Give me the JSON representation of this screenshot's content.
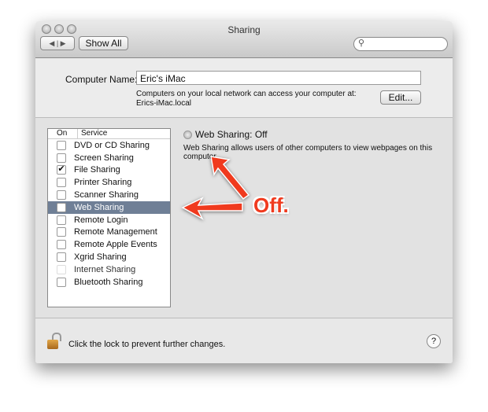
{
  "window": {
    "title": "Sharing"
  },
  "toolbar": {
    "back_icon": "triangle-left",
    "forward_icon": "triangle-right",
    "show_all": "Show All",
    "search_placeholder": ""
  },
  "computer": {
    "label": "Computer Name:",
    "value": "Eric's iMac",
    "info": "Computers on your local network can access your computer at:",
    "address": "Erics-iMac.local",
    "edit": "Edit..."
  },
  "list": {
    "col_on": "On",
    "col_service": "Service",
    "items": [
      {
        "label": "DVD or CD Sharing",
        "checked": false
      },
      {
        "label": "Screen Sharing",
        "checked": false
      },
      {
        "label": "File Sharing",
        "checked": true
      },
      {
        "label": "Printer Sharing",
        "checked": false
      },
      {
        "label": "Scanner Sharing",
        "checked": false
      },
      {
        "label": "Web Sharing",
        "checked": false,
        "selected": true
      },
      {
        "label": "Remote Login",
        "checked": false
      },
      {
        "label": "Remote Management",
        "checked": false
      },
      {
        "label": "Remote Apple Events",
        "checked": false
      },
      {
        "label": "Xgrid Sharing",
        "checked": false
      },
      {
        "label": "Internet Sharing",
        "checked": false,
        "disabled": true
      },
      {
        "label": "Bluetooth Sharing",
        "checked": false
      }
    ]
  },
  "detail": {
    "status": "Web Sharing: Off",
    "description": "Web Sharing allows users of other computers to view webpages on this computer."
  },
  "footer": {
    "lock_text": "Click the lock to prevent further changes.",
    "help": "?"
  },
  "annotation": {
    "text": "Off.",
    "color": "#f03a1e"
  }
}
